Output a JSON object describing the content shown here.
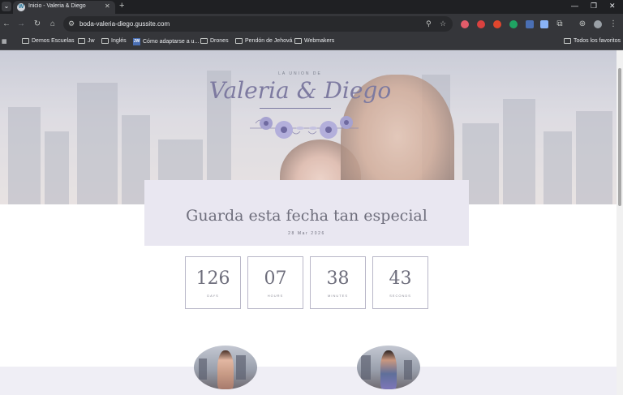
{
  "browser": {
    "tab_title": "Inicio - Valeria & Diego",
    "tab_favicon_letter": "W",
    "url": "boda-valeria-diego.gussite.com",
    "new_tab_glyph": "+",
    "icons": [
      "tab-search-icon",
      "wordpress-icon",
      "close-icon",
      "plus-icon",
      "minimize-icon",
      "maximize-icon",
      "close-window-icon",
      "back-icon",
      "forward-icon",
      "reload-icon",
      "home-icon",
      "site-info-icon",
      "zoom-icon",
      "star-icon",
      "pocket-icon",
      "extension-icon",
      "puzzle-icon",
      "profile-icon",
      "menu-icon",
      "apps-icon",
      "folder-icon"
    ]
  },
  "bookmarks": {
    "items": [
      {
        "label": "Demos Escuelas",
        "type": "folder"
      },
      {
        "label": "Jw",
        "type": "folder"
      },
      {
        "label": "Inglés",
        "type": "folder"
      },
      {
        "label": "Cómo adaptarse a u...",
        "type": "jw"
      },
      {
        "label": "Drones",
        "type": "folder"
      },
      {
        "label": "Pendón de Jehová",
        "type": "folder"
      },
      {
        "label": "Webmakers",
        "type": "folder"
      }
    ],
    "all_favorites": "Todos los favoritos",
    "jw_badge": "JW"
  },
  "hero": {
    "kicker": "LA UNION DE",
    "names": "Valeria & Diego"
  },
  "save_date": {
    "title": "Guarda esta fecha tan especial",
    "date": "28 Mar 2026"
  },
  "countdown": [
    {
      "value": "126",
      "label": "DAYS"
    },
    {
      "value": "07",
      "label": "HOURS"
    },
    {
      "value": "38",
      "label": "MINUTES"
    },
    {
      "value": "43",
      "label": "SECONDS"
    }
  ],
  "colors": {
    "accent": "#7d7aa0",
    "date_box": "#e9e7f1",
    "band": "#efeef5"
  }
}
